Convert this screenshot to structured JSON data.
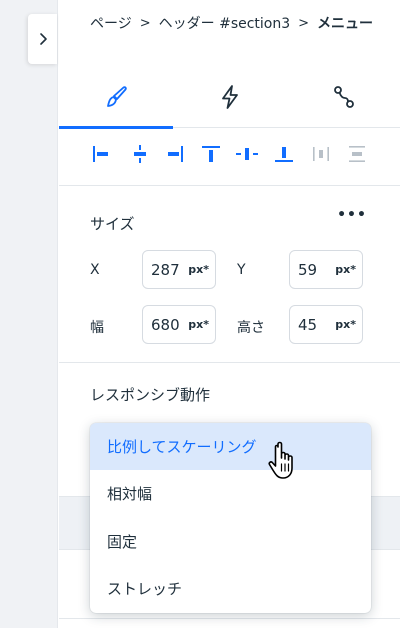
{
  "breadcrumb": {
    "items": [
      "ページ",
      "ヘッダー #section3",
      "メニュー"
    ],
    "separator": ">"
  },
  "tabs": [
    {
      "name": "design",
      "icon": "paintbrush-icon",
      "active": true
    },
    {
      "name": "interactions",
      "icon": "lightning-icon",
      "active": false
    },
    {
      "name": "connections",
      "icon": "connect-icon",
      "active": false
    }
  ],
  "alignment_tools": [
    "align-left-icon",
    "align-center-horizontal-icon",
    "align-right-icon",
    "align-top-icon",
    "align-center-vertical-icon",
    "align-bottom-icon",
    "distribute-horizontal-icon",
    "distribute-vertical-icon"
  ],
  "size": {
    "title": "サイズ",
    "more": "•••",
    "x": {
      "label": "X",
      "value": "287",
      "unit": "px*"
    },
    "y": {
      "label": "Y",
      "value": "59",
      "unit": "px*"
    },
    "width": {
      "label": "幅",
      "value": "680",
      "unit": "px*"
    },
    "height": {
      "label": "高さ",
      "value": "45",
      "unit": "px*"
    }
  },
  "responsive": {
    "title": "レスポンシブ動作",
    "options": [
      "比例してスケーリング",
      "相対幅",
      "固定",
      "ストレッチ"
    ],
    "selected_index": 0
  },
  "colors": {
    "accent": "#116dff",
    "selected_bg": "#dae8fc",
    "text": "#20303c"
  }
}
